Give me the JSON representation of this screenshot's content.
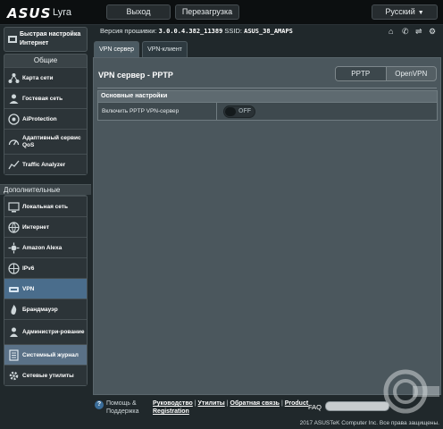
{
  "header": {
    "logo": "ASUS",
    "model": "Lyra",
    "logout_label": "Выход",
    "reboot_label": "Перезагрузка",
    "language": "Русский"
  },
  "info": {
    "firmware_label": "Версия прошивки:",
    "firmware_value": "3.0.0.4.382_11389",
    "ssid_label": "SSID:",
    "ssid_value": "ASUS_38_AMAPS"
  },
  "sidebar": {
    "quick_setup": "Быстрая настройка Интернет",
    "general_title": "Общие",
    "general_items": [
      {
        "label": "Карта сети",
        "icon": "network-map-icon"
      },
      {
        "label": "Гостевая сеть",
        "icon": "guest-network-icon"
      },
      {
        "label": "AiProtection",
        "icon": "aiprotection-icon"
      },
      {
        "label": "Адаптивный сервис QoS",
        "icon": "qos-icon"
      },
      {
        "label": "Traffic Analyzer",
        "icon": "traffic-analyzer-icon"
      }
    ],
    "advanced_title": "Дополнительные настройки",
    "advanced_items": [
      {
        "label": "Локальная сеть",
        "icon": "lan-icon"
      },
      {
        "label": "Интернет",
        "icon": "wan-icon"
      },
      {
        "label": "Amazon Alexa",
        "icon": "alexa-icon"
      },
      {
        "label": "IPv6",
        "icon": "ipv6-icon"
      },
      {
        "label": "VPN",
        "icon": "vpn-icon"
      },
      {
        "label": "Брандмауэр",
        "icon": "firewall-icon"
      },
      {
        "label": "Администри-рование",
        "icon": "admin-icon"
      },
      {
        "label": "Системный журнал",
        "icon": "syslog-icon"
      },
      {
        "label": "Сетевые утилиты",
        "icon": "network-tools-icon"
      }
    ],
    "active_item": "VPN",
    "hover_item": "Системный журнал"
  },
  "tabs": [
    "VPN сервер",
    "VPN-клиент"
  ],
  "main": {
    "title": "VPN сервер - PPTP",
    "segments": [
      "PPTP",
      "OpenVPN"
    ],
    "selected_segment": "PPTP",
    "section_title": "Основные настройки",
    "rows": [
      {
        "label": "Включить PPTP VPN-сервер",
        "toggle": "OFF"
      }
    ]
  },
  "footer": {
    "help": "Помощь & Поддержка",
    "links": [
      "Руководство",
      "Утилиты",
      "Обратная связь",
      "Product Registration"
    ],
    "faq": "FAQ",
    "copyright": "2017 ASUSTeK Computer Inc. Все права защищены."
  },
  "colors": {
    "active_nav": "#4a6d8c",
    "background": "#20282b",
    "panel": "#4b575d"
  }
}
